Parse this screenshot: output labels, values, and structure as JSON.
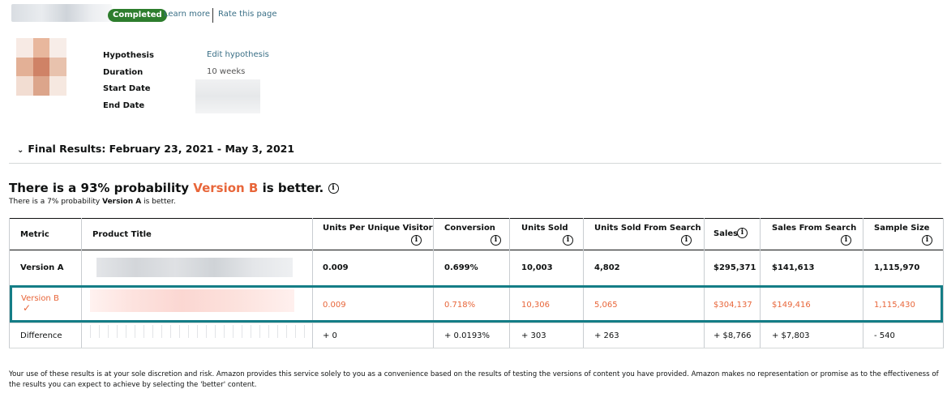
{
  "topbar": {
    "status": "Completed",
    "learn_more": "Learn more",
    "rate_page": "Rate this page"
  },
  "info": {
    "hypothesis_label": "Hypothesis",
    "hypothesis_value": "Edit hypothesis",
    "duration_label": "Duration",
    "duration_value": "10 weeks",
    "start_label": "Start Date",
    "end_label": "End Date"
  },
  "results": {
    "header": "Final Results: February 23, 2021 - May 3, 2021",
    "prob_prefix": "There is a 93% probability ",
    "prob_version": "Version B",
    "prob_suffix": " is better.",
    "sub_prefix": "There is a 7% probability ",
    "sub_version": "Version A",
    "sub_suffix": " is better."
  },
  "table": {
    "headers": {
      "metric": "Metric",
      "product_title": "Product Title",
      "upuv": "Units Per Unique Visitor",
      "conversion": "Conversion",
      "units_sold": "Units Sold",
      "units_search": "Units Sold From Search",
      "sales": "Sales",
      "sales_search": "Sales From Search",
      "sample": "Sample Size"
    },
    "rows": [
      {
        "metric": "Version A",
        "upuv": "0.009",
        "conversion": "0.699%",
        "units_sold": "10,003",
        "units_search": "4,802",
        "sales": "$295,371",
        "sales_search": "$141,613",
        "sample": "1,115,970"
      },
      {
        "metric": "Version B",
        "upuv": "0.009",
        "conversion": "0.718%",
        "units_sold": "10,306",
        "units_search": "5,065",
        "sales": "$304,137",
        "sales_search": "$149,416",
        "sample": "1,115,430"
      },
      {
        "metric": "Difference",
        "upuv": "+ 0",
        "conversion": "+ 0.0193%",
        "units_sold": "+ 303",
        "units_search": "+ 263",
        "sales": "+ $8,766",
        "sales_search": "+ $7,803",
        "sample": "- 540"
      }
    ]
  },
  "disclaimer": "Your use of these results is at your sole discretion and risk. Amazon provides this service solely to you as a convenience based on the results of testing the versions of content you have provided. Amazon makes no representation or promise as to the effectiveness of the results you can expect to achieve by selecting the 'better' content.",
  "colors": {
    "accent_version_b": "#e8663a",
    "completed_badge": "#2d7d2d",
    "link": "#3a6f86",
    "highlight_border": "#147d86"
  },
  "icons": {
    "info": "info-circle-icon",
    "chevron": "chevron-down-icon",
    "check": "checkmark-icon"
  }
}
